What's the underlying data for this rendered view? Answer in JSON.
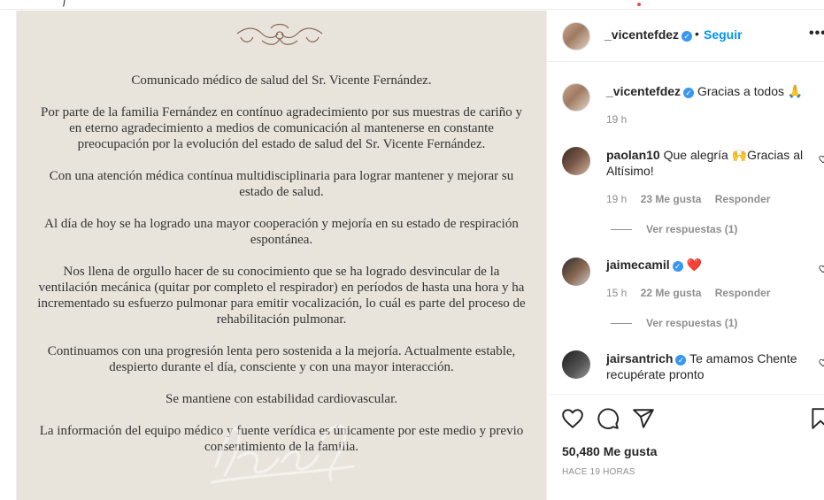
{
  "post": {
    "document": {
      "title": "Comunicado médico de salud del Sr. Vicente Fernández.",
      "paragraphs": [
        "Por parte de la familia Fernández en contínuo agradecimiento por sus muestras de cariño y en eterno agradecimiento a medios de comunicación al mantenerse en constante preocupación por la evolución del estado de salud del Sr. Vicente Fernández.",
        "Con una atención médica contínua multidisciplinaria para lograr mantener y mejorar su estado de salud.",
        "Al día de hoy se ha logrado una mayor cooperación y mejoría en su estado de respiración espontánea.",
        "Nos llena de orgullo hacer de su conocimiento que se ha logrado desvincular de la ventilación mecánica (quitar por completo el respirador) en períodos de hasta una hora y ha incrementado su esfuerzo pulmonar para emitir vocalización, lo cuál es parte del proceso de rehabilitación pulmonar.",
        "Continuamos con una progresión lenta pero sostenida a la mejoría. Actualmente estable, despierto durante el día, consciente y con una mayor interacción.",
        "Se mantiene con estabilidad cardiovascular.",
        "La información del equipo médico y fuente verídica es únicamente por este medio y previo consentimiento de la familia."
      ]
    }
  },
  "header": {
    "username": "_vicentefdez",
    "separator": "•",
    "follow_label": "Seguir",
    "more_label": "•••"
  },
  "caption": {
    "username": "_vicentefdez",
    "text": "Gracias a todos 🙏",
    "time": "19 h"
  },
  "comments": [
    {
      "username": "paolan10",
      "text": "Que alegría 🙌Gracias al Altísimo!",
      "time": "19 h",
      "likes": "23 Me gusta",
      "reply": "Responder",
      "view_replies": "Ver respuestas (1)"
    },
    {
      "username": "jaimecamil",
      "text": "❤️",
      "time": "15 h",
      "likes": "22 Me gusta",
      "reply": "Responder",
      "view_replies": "Ver respuestas (1)"
    },
    {
      "username": "jairsantrich",
      "text": "Te amamos Chente recupérate pronto"
    }
  ],
  "footer": {
    "likes": "50,480 Me gusta",
    "posted": "HACE 19 HORAS"
  },
  "colors": {
    "link": "#0095f6",
    "verified": "#3897f0",
    "heart": "#ed1c24",
    "document_bg": "#e8e4dc"
  }
}
